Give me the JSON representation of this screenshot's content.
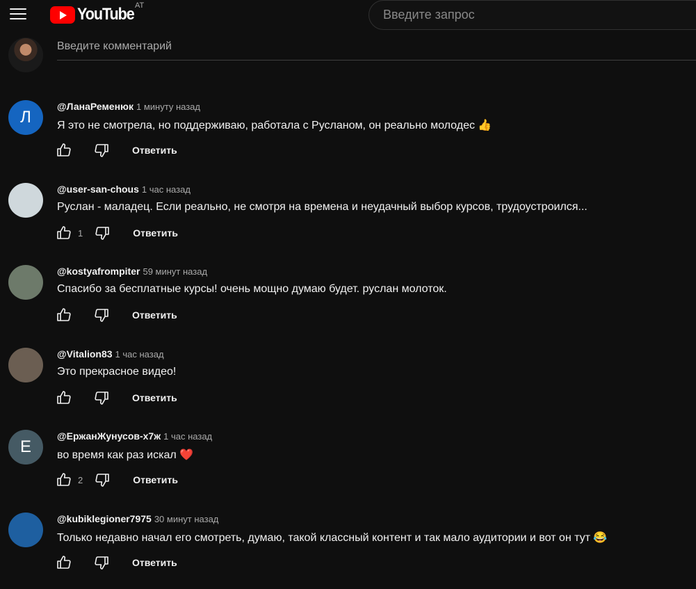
{
  "header": {
    "logo_text": "YouTube",
    "country_code": "AT",
    "search_placeholder": "Введите запрос"
  },
  "add_comment": {
    "placeholder": "Введите комментарий"
  },
  "reply_label": "Ответить",
  "comments": [
    {
      "avatar_letter": "Л",
      "avatar_color": "#1565c0",
      "author": "@ЛанаРеменюк",
      "time": "1 минуту назад",
      "text": "Я это не смотрела, но поддерживаю, работала с Русланом, он реально молодес",
      "emoji": "👍",
      "likes": ""
    },
    {
      "avatar_letter": "",
      "avatar_color": "#cfd8dc",
      "author": "@user-san-chous",
      "time": "1 час назад",
      "text": "Руслан - маладец. Если реально, не смотря на времена и неудачный выбор курсов, трудоустроился...",
      "emoji": "",
      "likes": "1"
    },
    {
      "avatar_letter": "",
      "avatar_color": "#6d7a6a",
      "author": "@kostyafrompiter",
      "time": "59 минут назад",
      "text": "Спасибо за бесплатные курсы! очень мощно думаю будет. руслан молоток.",
      "emoji": "",
      "likes": ""
    },
    {
      "avatar_letter": "",
      "avatar_color": "#6b5e52",
      "author": "@Vitalion83",
      "time": "1 час назад",
      "text": "Это прекрасное видео!",
      "emoji": "",
      "likes": ""
    },
    {
      "avatar_letter": "E",
      "avatar_color": "#455a64",
      "author": "@ЕржанЖунусов-х7ж",
      "time": "1 час назад",
      "text": "во время как раз искал",
      "emoji": "❤️",
      "likes": "2"
    },
    {
      "avatar_letter": "",
      "avatar_color": "#1e5fa0",
      "author": "@kubiklegioner7975",
      "time": "30 минут назад",
      "text": "Только недавно начал его смотреть, думаю, такой классный контент и так мало аудитории и вот он тут",
      "emoji": "😂",
      "likes": ""
    }
  ]
}
